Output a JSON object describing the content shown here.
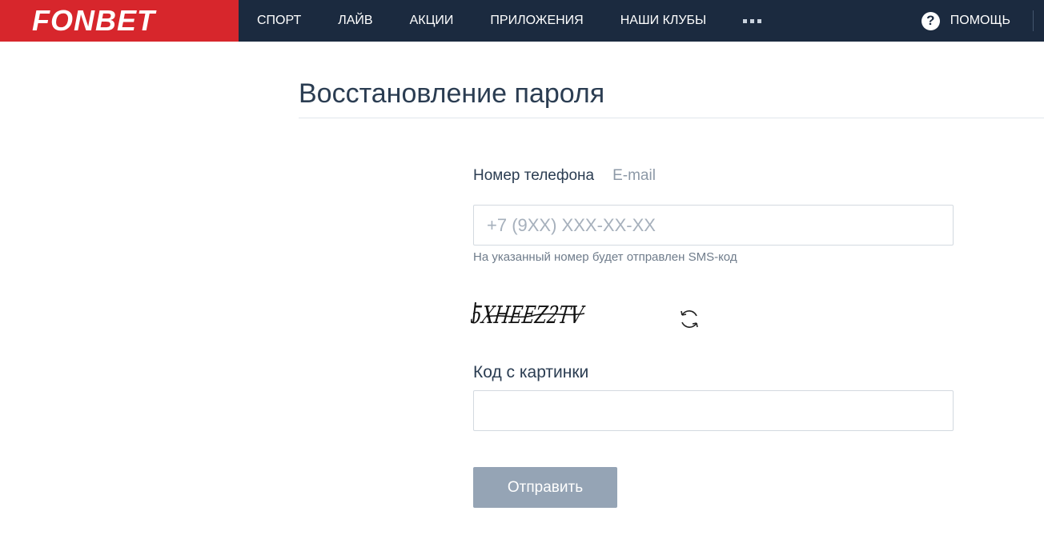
{
  "header": {
    "logo": "FONBET",
    "nav": [
      {
        "label": "СПОРТ"
      },
      {
        "label": "ЛАЙВ"
      },
      {
        "label": "АКЦИИ"
      },
      {
        "label": "ПРИЛОЖЕНИЯ"
      },
      {
        "label": "НАШИ КЛУБЫ"
      }
    ],
    "more_icon": "more-dots-icon",
    "help": {
      "icon": "question-icon",
      "icon_glyph": "?",
      "label": "ПОМОЩЬ"
    }
  },
  "page": {
    "title": "Восстановление пароля"
  },
  "form": {
    "tabs": [
      {
        "label": "Номер телефона",
        "active": true
      },
      {
        "label": "E-mail",
        "active": false
      }
    ],
    "phone": {
      "placeholder": "+7 (9XX) XXX-XX-XX",
      "value": "",
      "hint": "На указанный номер будет отправлен SMS-код"
    },
    "captcha": {
      "text": "5XHEEZ2TV",
      "refresh_icon": "refresh-icon"
    },
    "code": {
      "label": "Код с картинки",
      "value": ""
    },
    "submit_label": "Отправить"
  },
  "colors": {
    "brand_red": "#d7262c",
    "header_bg": "#1b2a3f",
    "text_primary": "#2b3d52",
    "text_muted": "#8d99a7",
    "button_disabled": "#95a4b5"
  }
}
